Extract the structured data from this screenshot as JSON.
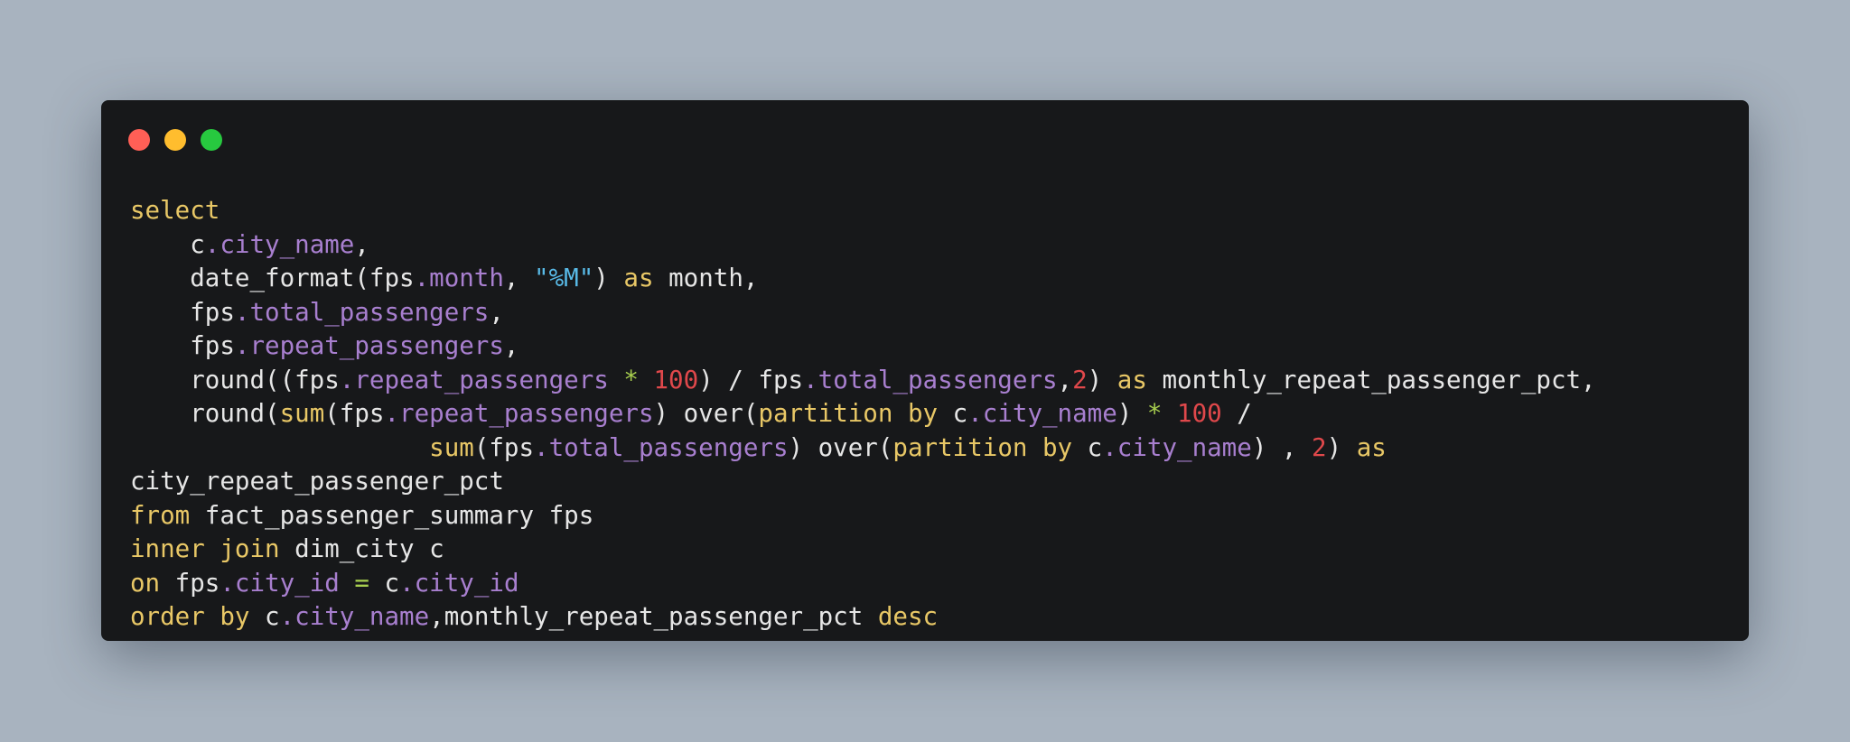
{
  "window_controls": [
    {
      "name": "close-button",
      "color": "#ff5f56"
    },
    {
      "name": "minimize-button",
      "color": "#ffbd2e"
    },
    {
      "name": "maximize-button",
      "color": "#27c93f"
    }
  ],
  "colors": {
    "background": "#a8b3bf",
    "window": "#17181a",
    "keyword": "#e8c766",
    "identifier": "#e6e6e6",
    "property": "#a87fcf",
    "string": "#58b9e6",
    "number": "#e0484b",
    "operator": "#a8cf4f"
  },
  "code_lines": [
    [
      {
        "t": "kw",
        "v": "select"
      }
    ],
    [
      {
        "t": "id",
        "v": "    c"
      },
      {
        "t": "pr",
        "v": ".city_name"
      },
      {
        "t": "p",
        "v": ","
      }
    ],
    [
      {
        "t": "id",
        "v": "    date_format(fps"
      },
      {
        "t": "pr",
        "v": ".month"
      },
      {
        "t": "p",
        "v": ", "
      },
      {
        "t": "str",
        "v": "\"%M\""
      },
      {
        "t": "p",
        "v": ") "
      },
      {
        "t": "kw",
        "v": "as"
      },
      {
        "t": "id",
        "v": " month,"
      }
    ],
    [
      {
        "t": "id",
        "v": "    fps"
      },
      {
        "t": "pr",
        "v": ".total_passengers"
      },
      {
        "t": "p",
        "v": ","
      }
    ],
    [
      {
        "t": "id",
        "v": "    fps"
      },
      {
        "t": "pr",
        "v": ".repeat_passengers"
      },
      {
        "t": "p",
        "v": ","
      }
    ],
    [
      {
        "t": "id",
        "v": "    round((fps"
      },
      {
        "t": "pr",
        "v": ".repeat_passengers"
      },
      {
        "t": "p",
        "v": " "
      },
      {
        "t": "op",
        "v": "*"
      },
      {
        "t": "p",
        "v": " "
      },
      {
        "t": "num",
        "v": "100"
      },
      {
        "t": "p",
        "v": ") / fps"
      },
      {
        "t": "pr",
        "v": ".total_passengers"
      },
      {
        "t": "p",
        "v": ","
      },
      {
        "t": "num",
        "v": "2"
      },
      {
        "t": "p",
        "v": ") "
      },
      {
        "t": "kw",
        "v": "as"
      },
      {
        "t": "id",
        "v": " monthly_repeat_passenger_pct,"
      }
    ],
    [
      {
        "t": "id",
        "v": "    round("
      },
      {
        "t": "fn",
        "v": "sum"
      },
      {
        "t": "p",
        "v": "(fps"
      },
      {
        "t": "pr",
        "v": ".repeat_passengers"
      },
      {
        "t": "p",
        "v": ") over("
      },
      {
        "t": "kw",
        "v": "partition by"
      },
      {
        "t": "p",
        "v": " c"
      },
      {
        "t": "pr",
        "v": ".city_name"
      },
      {
        "t": "p",
        "v": ") "
      },
      {
        "t": "op",
        "v": "*"
      },
      {
        "t": "p",
        "v": " "
      },
      {
        "t": "num",
        "v": "100"
      },
      {
        "t": "p",
        "v": " /"
      }
    ],
    [
      {
        "t": "p",
        "v": "                    "
      },
      {
        "t": "fn",
        "v": "sum"
      },
      {
        "t": "p",
        "v": "(fps"
      },
      {
        "t": "pr",
        "v": ".total_passengers"
      },
      {
        "t": "p",
        "v": ") over("
      },
      {
        "t": "kw",
        "v": "partition by"
      },
      {
        "t": "p",
        "v": " c"
      },
      {
        "t": "pr",
        "v": ".city_name"
      },
      {
        "t": "p",
        "v": ") , "
      },
      {
        "t": "num",
        "v": "2"
      },
      {
        "t": "p",
        "v": ") "
      },
      {
        "t": "kw",
        "v": "as"
      }
    ],
    [
      {
        "t": "id",
        "v": "city_repeat_passenger_pct"
      }
    ],
    [
      {
        "t": "kw",
        "v": "from"
      },
      {
        "t": "id",
        "v": " fact_passenger_summary fps"
      }
    ],
    [
      {
        "t": "kw",
        "v": "inner join"
      },
      {
        "t": "id",
        "v": " dim_city c"
      }
    ],
    [
      {
        "t": "kw",
        "v": "on"
      },
      {
        "t": "id",
        "v": " fps"
      },
      {
        "t": "pr",
        "v": ".city_id"
      },
      {
        "t": "p",
        "v": " "
      },
      {
        "t": "op",
        "v": "="
      },
      {
        "t": "p",
        "v": " c"
      },
      {
        "t": "pr",
        "v": ".city_id"
      }
    ],
    [
      {
        "t": "kw",
        "v": "order by"
      },
      {
        "t": "id",
        "v": " c"
      },
      {
        "t": "pr",
        "v": ".city_name"
      },
      {
        "t": "p",
        "v": ",monthly_repeat_passenger_pct "
      },
      {
        "t": "kw",
        "v": "desc"
      }
    ]
  ]
}
